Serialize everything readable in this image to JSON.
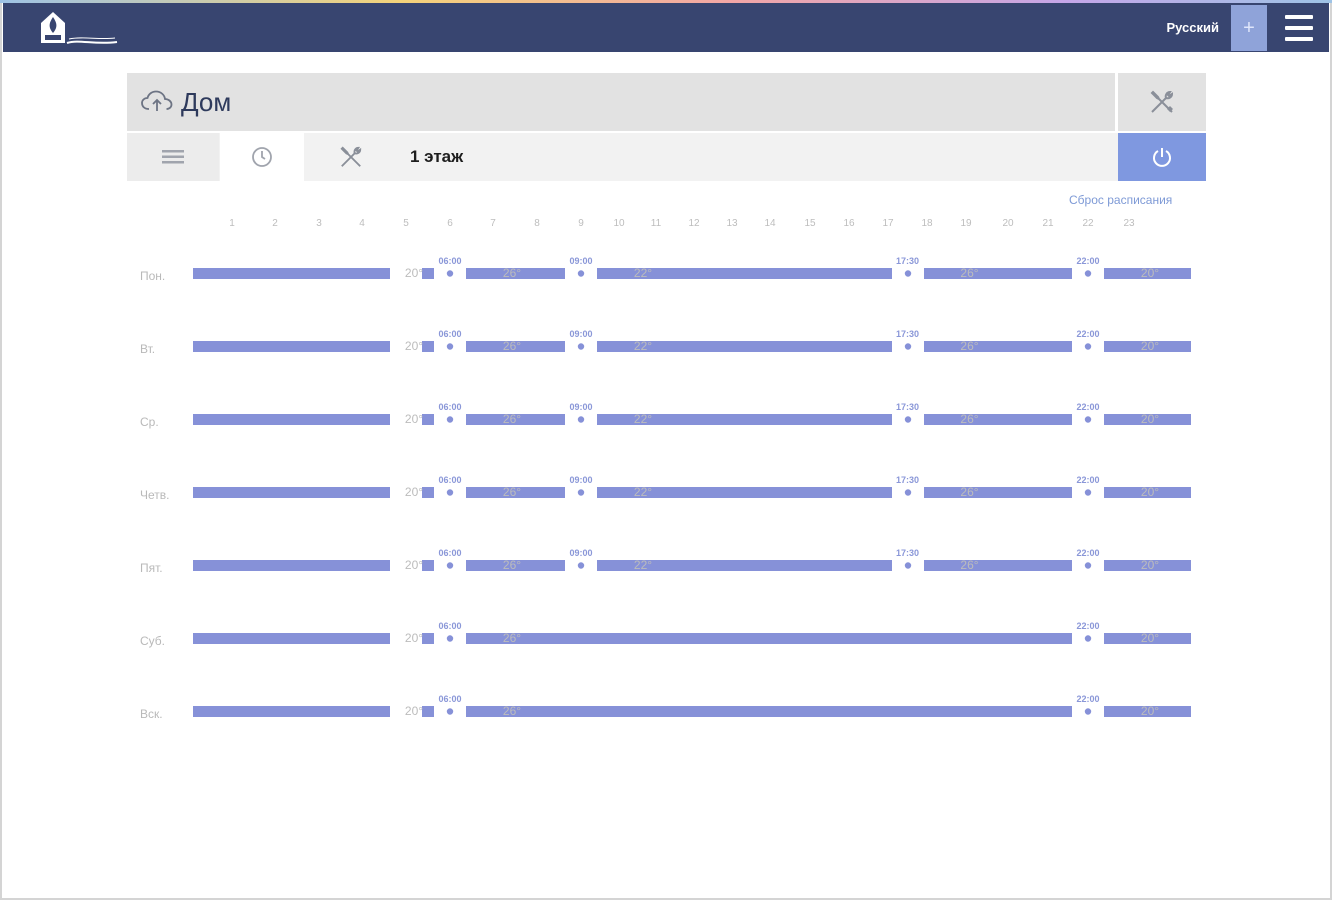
{
  "topbar": {
    "language": "Русский",
    "plus_label": "+",
    "logo_icon": "house-flame-logo"
  },
  "header": {
    "title": "Дом",
    "cloud_icon": "cloud-upload-icon",
    "tools_icon": "wrench-screwdriver-icon"
  },
  "tabs": {
    "floor": "1 этаж",
    "list_icon": "list-icon",
    "clock_icon": "clock-icon",
    "tools_icon": "tools-icon",
    "power_icon": "power-icon"
  },
  "reset_label": "Сброс расписания",
  "hours": [
    "1",
    "2",
    "3",
    "4",
    "5",
    "6",
    "7",
    "8",
    "9",
    "10",
    "11",
    "12",
    "13",
    "14",
    "15",
    "16",
    "17",
    "18",
    "19",
    "20",
    "21",
    "22",
    "23"
  ],
  "days": [
    {
      "label": "Пон.",
      "switches": [
        "06:00",
        "09:00",
        "17:30",
        "22:00"
      ],
      "temps": [
        "20°",
        "26°",
        "22°",
        "26°",
        "20°"
      ]
    },
    {
      "label": "Вт.",
      "switches": [
        "06:00",
        "09:00",
        "17:30",
        "22:00"
      ],
      "temps": [
        "20°",
        "26°",
        "22°",
        "26°",
        "20°"
      ]
    },
    {
      "label": "Ср.",
      "switches": [
        "06:00",
        "09:00",
        "17:30",
        "22:00"
      ],
      "temps": [
        "20°",
        "26°",
        "22°",
        "26°",
        "20°"
      ]
    },
    {
      "label": "Четв.",
      "switches": [
        "06:00",
        "09:00",
        "17:30",
        "22:00"
      ],
      "temps": [
        "20°",
        "26°",
        "22°",
        "26°",
        "20°"
      ]
    },
    {
      "label": "Пят.",
      "switches": [
        "06:00",
        "09:00",
        "17:30",
        "22:00"
      ],
      "temps": [
        "20°",
        "26°",
        "22°",
        "26°",
        "20°"
      ]
    },
    {
      "label": "Суб.",
      "switches": [
        "06:00",
        "22:00"
      ],
      "temps": [
        "20°",
        "26°",
        "20°"
      ]
    },
    {
      "label": "Вск.",
      "switches": [
        "06:00",
        "22:00"
      ],
      "temps": [
        "20°",
        "26°",
        "20°"
      ]
    }
  ],
  "colors": {
    "topbar": "#384570",
    "accent": "#7f98e0",
    "bar": "#8691d8",
    "link": "#7e9ad6"
  }
}
